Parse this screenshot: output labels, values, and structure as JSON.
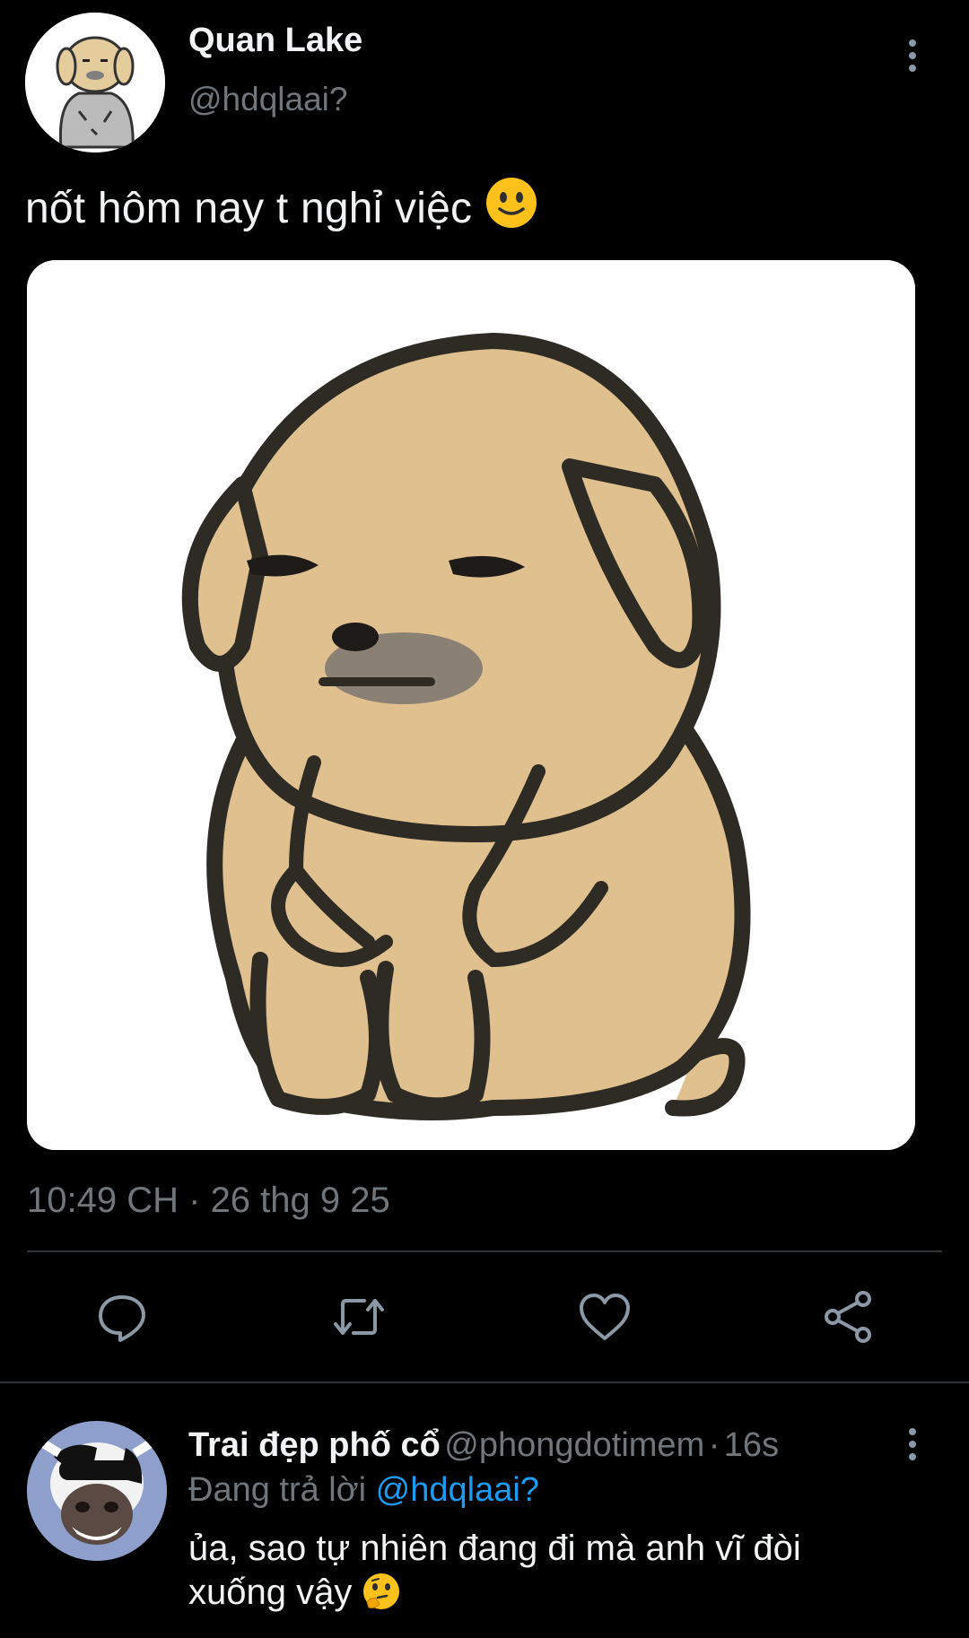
{
  "tweet": {
    "display_name": "Quan Lake",
    "handle": "@hdqlaai?",
    "text": "nốt hôm nay t nghỉ việc",
    "text_emoji": "slightly-smiling-face",
    "time": "10:49 CH",
    "separator": "·",
    "date": "26 thg 9 25",
    "avatar_icon": "dog-avatar-icon",
    "media_icon": "sad-dog-illustration"
  },
  "actions": [
    {
      "name": "reply",
      "icon": "reply-icon"
    },
    {
      "name": "retweet",
      "icon": "retweet-icon"
    },
    {
      "name": "like",
      "icon": "heart-icon"
    },
    {
      "name": "share",
      "icon": "share-icon"
    }
  ],
  "reply": {
    "display_name": "Trai đẹp phố cổ",
    "handle": "@phongdotimem",
    "separator": "·",
    "age": "16s",
    "replying_prefix": "Đang trả lời",
    "replying_to": "@hdqlaai?",
    "text_line1": "ủa, sao tự nhiên đang đi mà anh vĩ đòi",
    "text_line2": "xuống vậy",
    "text_emoji": "thinking-face",
    "avatar_icon": "cow-avatar-icon"
  },
  "colors": {
    "background": "#000000",
    "muted": "#71767b",
    "link": "#1d9bf0",
    "divider": "#2f3336",
    "dog_fill": "#dfc08e"
  }
}
